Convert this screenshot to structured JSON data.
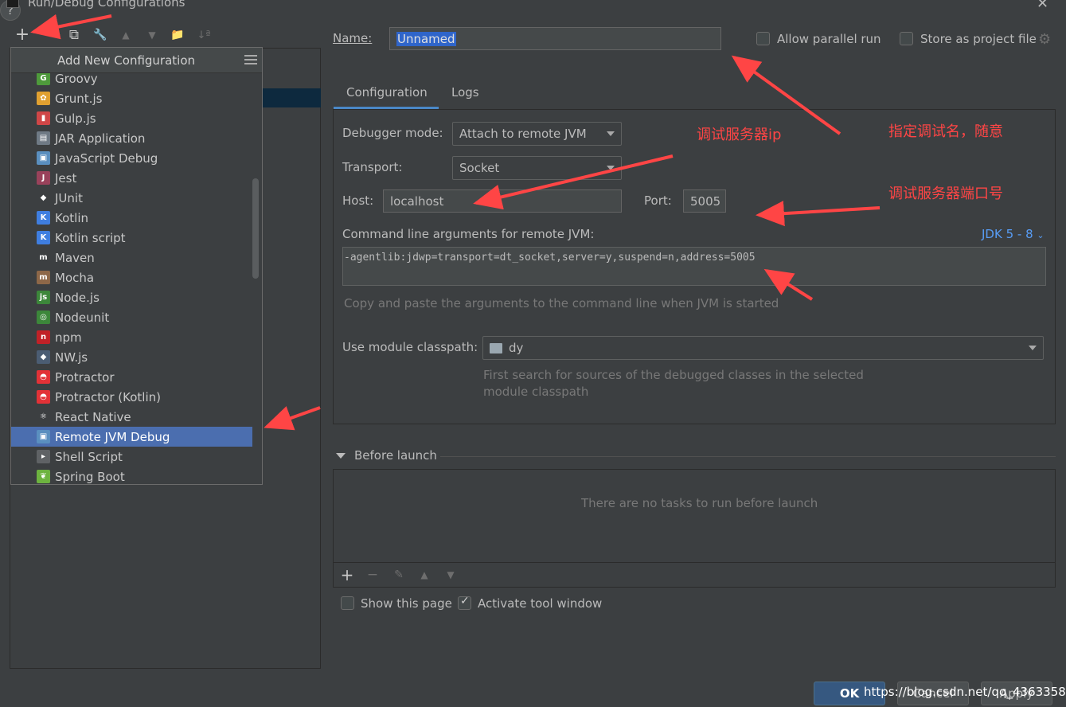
{
  "window": {
    "title": "Run/Debug Configurations"
  },
  "toolbar": {
    "add": "+",
    "remove": "−",
    "copy": "⧉",
    "edit": "🔧",
    "up": "▲",
    "down": "▼",
    "folder": "📁",
    "sort": "↓ª"
  },
  "popup": {
    "title": "Add New Configuration",
    "items": [
      {
        "label": "Groovy",
        "icon": "groovy-icon",
        "color": "#4e9a3b",
        "glyph": "G"
      },
      {
        "label": "Grunt.js",
        "icon": "grunt-icon",
        "color": "#e0a030",
        "glyph": "✿"
      },
      {
        "label": "Gulp.js",
        "icon": "gulp-icon",
        "color": "#cf4647",
        "glyph": "▮"
      },
      {
        "label": "JAR Application",
        "icon": "jar-icon",
        "color": "#6f7a85",
        "glyph": "▤"
      },
      {
        "label": "JavaScript Debug",
        "icon": "js-debug-icon",
        "color": "#5a8fbf",
        "glyph": "▣"
      },
      {
        "label": "Jest",
        "icon": "jest-icon",
        "color": "#99425b",
        "glyph": "J"
      },
      {
        "label": "JUnit",
        "icon": "junit-icon",
        "color": "#3c3f41",
        "glyph": "◆"
      },
      {
        "label": "Kotlin",
        "icon": "kotlin-icon",
        "color": "#3f7ee0",
        "glyph": "K"
      },
      {
        "label": "Kotlin script",
        "icon": "kotlin-script-icon",
        "color": "#3f7ee0",
        "glyph": "K"
      },
      {
        "label": "Maven",
        "icon": "maven-icon",
        "color": "#3c3f41",
        "glyph": "m"
      },
      {
        "label": "Mocha",
        "icon": "mocha-icon",
        "color": "#8d6748",
        "glyph": "m"
      },
      {
        "label": "Node.js",
        "icon": "nodejs-icon",
        "color": "#3c873a",
        "glyph": "js"
      },
      {
        "label": "Nodeunit",
        "icon": "nodeunit-icon",
        "color": "#3c873a",
        "glyph": "◎"
      },
      {
        "label": "npm",
        "icon": "npm-icon",
        "color": "#c12127",
        "glyph": "n"
      },
      {
        "label": "NW.js",
        "icon": "nwjs-icon",
        "color": "#4b5d73",
        "glyph": "◆"
      },
      {
        "label": "Protractor",
        "icon": "protractor-icon",
        "color": "#e23237",
        "glyph": "◓"
      },
      {
        "label": "Protractor (Kotlin)",
        "icon": "protractor-kotlin-icon",
        "color": "#e23237",
        "glyph": "◓"
      },
      {
        "label": "React Native",
        "icon": "react-icon",
        "color": "#3c3f41",
        "glyph": "⚛"
      },
      {
        "label": "Remote JVM Debug",
        "icon": "remote-debug-icon",
        "color": "#5a8fbf",
        "glyph": "▣"
      },
      {
        "label": "Shell Script",
        "icon": "shell-icon",
        "color": "#5f6265",
        "glyph": "▸"
      },
      {
        "label": "Spring Boot",
        "icon": "spring-icon",
        "color": "#6db33f",
        "glyph": "❦"
      }
    ],
    "selected_index": 18
  },
  "name": {
    "label": "Name:",
    "value": "Unnamed"
  },
  "options": {
    "parallel": "Allow parallel run",
    "store": "Store as project file"
  },
  "tabs": [
    "Configuration",
    "Logs"
  ],
  "config": {
    "debugger_mode_label": "Debugger mode:",
    "debugger_mode_value": "Attach to remote JVM",
    "transport_label": "Transport:",
    "transport_value": "Socket",
    "host_label": "Host:",
    "host_value": "localhost",
    "port_label": "Port:",
    "port_value": "5005",
    "cmd_label": "Command line arguments for remote JVM:",
    "jdk_link": "JDK 5 - 8",
    "cmd_value": "-agentlib:jdwp=transport=dt_socket,server=y,suspend=n,address=5005",
    "cmd_hint": "Copy and paste the arguments to the command line when JVM is started",
    "module_label": "Use module classpath:",
    "module_value": "dy",
    "module_hint_1": "First search for sources of the debugged classes in the selected",
    "module_hint_2": "module classpath"
  },
  "before_launch": {
    "title": "Before launch",
    "empty": "There are no tasks to run before launch",
    "show_page": "Show this page",
    "activate": "Activate tool window"
  },
  "annotations": {
    "server_ip": "调试服务器ip",
    "debug_name": "指定调试名，随意",
    "server_port": "调试服务器端口号"
  },
  "buttons": {
    "ok": "OK",
    "cancel": "Cancel",
    "apply": "Apply"
  },
  "watermark": "https://blog.csdn.net/qq_43633589",
  "colors": {
    "accent": "#4b6eaf",
    "arrow": "#ff4545",
    "link": "#589df6"
  }
}
